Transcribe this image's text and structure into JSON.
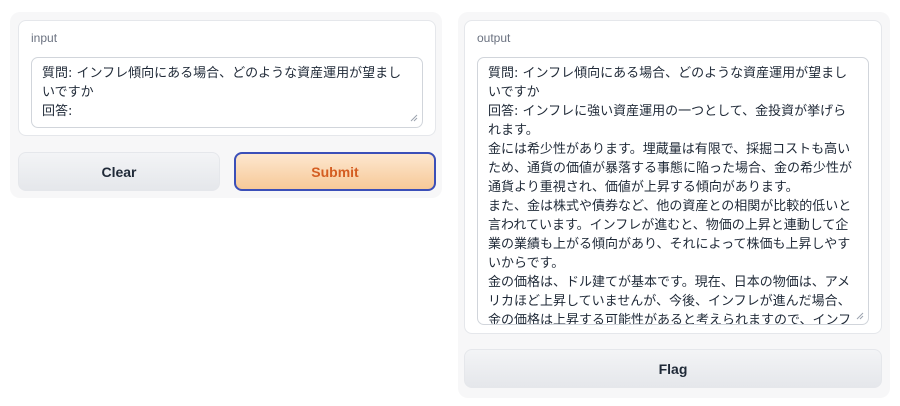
{
  "input_panel": {
    "label": "input",
    "textbox_value": "質問: インフレ傾向にある場合、どのような資産運用が望ましいですか\n回答:"
  },
  "buttons": {
    "clear_label": "Clear",
    "submit_label": "Submit",
    "flag_label": "Flag"
  },
  "output_panel": {
    "label": "output",
    "textbox_value": "質問: インフレ傾向にある場合、どのような資産運用が望ましいですか\n回答: インフレに強い資産運用の一つとして、金投資が挙げられます。\n金には希少性があります。埋蔵量は有限で、採掘コストも高いため、通貨の価値が暴落する事態に陥った場合、金の希少性が通貨より重視され、価値が上昇する傾向があります。\nまた、金は株式や債券など、他の資産との相関が比較的低いと言われています。インフレが進むと、物価の上昇と連動して企業の業績も上がる傾向があり、それによって株価も上昇しやすいからです。\n金の価格は、ドル建てが基本です。現在、日本の物価は、アメリカほど上昇していませんが、今後、インフレが進んだ場合、金の価格は上昇する可能性があると考えられますので、インフレ"
  },
  "colors": {
    "primary_text": "#d45d21",
    "primary_border": "#3b4fb8",
    "primary_bg": "#f7c998"
  }
}
